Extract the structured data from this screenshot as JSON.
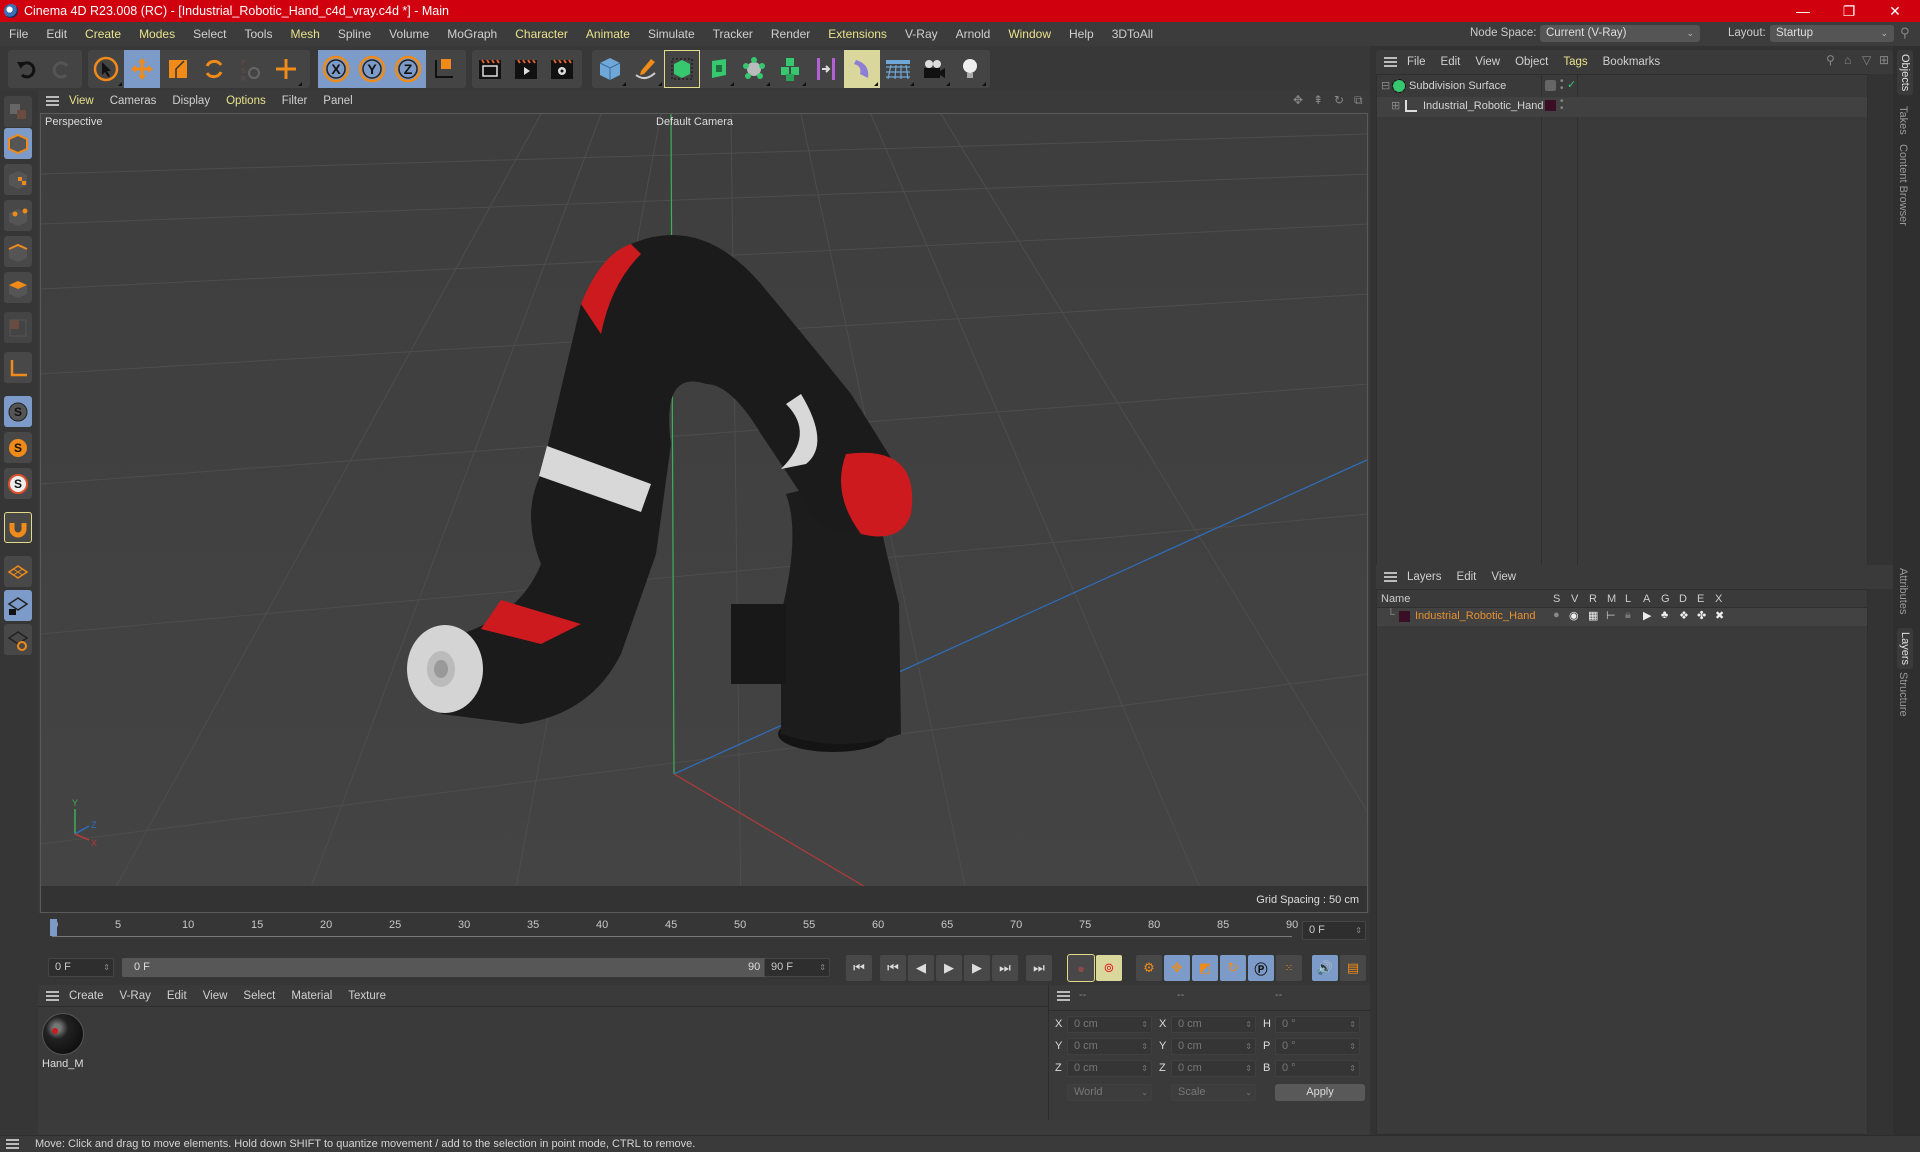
{
  "window": {
    "title": "Cinema 4D R23.008 (RC) - [Industrial_Robotic_Hand_c4d_vray.c4d *] - Main",
    "controls": {
      "minimize": "—",
      "restore": "❐",
      "close": "✕"
    }
  },
  "menubar": {
    "items": [
      {
        "label": "File",
        "hl": false
      },
      {
        "label": "Edit",
        "hl": false
      },
      {
        "label": "Create",
        "hl": true
      },
      {
        "label": "Modes",
        "hl": true
      },
      {
        "label": "Select",
        "hl": false
      },
      {
        "label": "Tools",
        "hl": false
      },
      {
        "label": "Mesh",
        "hl": true
      },
      {
        "label": "Spline",
        "hl": false
      },
      {
        "label": "Volume",
        "hl": false
      },
      {
        "label": "MoGraph",
        "hl": false
      },
      {
        "label": "Character",
        "hl": true
      },
      {
        "label": "Animate",
        "hl": true
      },
      {
        "label": "Simulate",
        "hl": false
      },
      {
        "label": "Tracker",
        "hl": false
      },
      {
        "label": "Render",
        "hl": false
      },
      {
        "label": "Extensions",
        "hl": true
      },
      {
        "label": "V-Ray",
        "hl": false
      },
      {
        "label": "Arnold",
        "hl": false
      },
      {
        "label": "Window",
        "hl": true
      },
      {
        "label": "Help",
        "hl": false
      },
      {
        "label": "3DToAll",
        "hl": false
      }
    ],
    "node_space_label": "Node Space:",
    "node_space_value": "Current (V-Ray)",
    "layout_label": "Layout:",
    "layout_value": "Startup"
  },
  "toolbar": {
    "undo": "undo-icon",
    "redo": "redo-icon",
    "modes": [
      "select-arrow",
      "move",
      "scale",
      "rotate",
      "psr-recent",
      "add-new"
    ],
    "axis": [
      "X",
      "Y",
      "Z"
    ],
    "render": [
      "render-view",
      "render-picture-viewer",
      "render-settings"
    ],
    "create": [
      "cube",
      "pen",
      "subdivision-surface",
      "extrude",
      "cloner",
      "multi-cubes",
      "symmetry",
      "deformer",
      "floor",
      "camera",
      "light"
    ]
  },
  "viewport": {
    "menu": [
      {
        "label": "View",
        "hl": true
      },
      {
        "label": "Cameras",
        "hl": false
      },
      {
        "label": "Display",
        "hl": false
      },
      {
        "label": "Options",
        "hl": true
      },
      {
        "label": "Filter",
        "hl": false
      },
      {
        "label": "Panel",
        "hl": false
      }
    ],
    "label": "Perspective",
    "camera": "Default Camera",
    "grid_spacing": "Grid Spacing : 50 cm",
    "axis_labels": {
      "y": "Y",
      "z": "Z",
      "x": "X"
    },
    "colors": {
      "red_accent": "#cc1a1f",
      "black_body": "#1b1b1b",
      "white_band": "#d8d8d8",
      "y_axis": "#3fae5a",
      "x_axis": "#b33a3a",
      "z_axis": "#2f6fc0"
    }
  },
  "timeline": {
    "ticks": [
      "0",
      "5",
      "10",
      "15",
      "20",
      "25",
      "30",
      "35",
      "40",
      "45",
      "50",
      "55",
      "60",
      "65",
      "70",
      "75",
      "80",
      "85",
      "90"
    ],
    "current_frame_right": "0 F",
    "start_field": "0 F",
    "range_start": "0 F",
    "range_end": "90 F",
    "end_field": "90 F"
  },
  "material_panel": {
    "menu": [
      "Create",
      "V-Ray",
      "Edit",
      "View",
      "Select",
      "Material",
      "Texture"
    ],
    "materials": [
      {
        "name": "Hand_M"
      }
    ]
  },
  "coordinates": {
    "headers": [
      "--",
      "--",
      "--"
    ],
    "rows": [
      {
        "l1": "X",
        "v1": "0 cm",
        "l2": "X",
        "v2": "0 cm",
        "l3": "H",
        "v3": "0 °"
      },
      {
        "l1": "Y",
        "v1": "0 cm",
        "l2": "Y",
        "v2": "0 cm",
        "l3": "P",
        "v3": "0 °"
      },
      {
        "l1": "Z",
        "v1": "0 cm",
        "l2": "Z",
        "v2": "0 cm",
        "l3": "B",
        "v3": "0 °"
      }
    ],
    "space": "World",
    "mode": "Scale",
    "apply": "Apply"
  },
  "objects_panel": {
    "menu": [
      {
        "label": "File",
        "hl": false
      },
      {
        "label": "Edit",
        "hl": false
      },
      {
        "label": "View",
        "hl": false
      },
      {
        "label": "Object",
        "hl": false
      },
      {
        "label": "Tags",
        "hl": true
      },
      {
        "label": "Bookmarks",
        "hl": false
      }
    ],
    "objects": [
      {
        "name": "Subdivision Surface",
        "icon": "subdivision-surface-icon"
      },
      {
        "name": "Industrial_Robotic_Hand",
        "icon": "null-object-icon",
        "layer_color": "#3a0f26"
      }
    ]
  },
  "layers_panel": {
    "menu": [
      "Layers",
      "Edit",
      "View"
    ],
    "columns": [
      "Name",
      "S",
      "V",
      "R",
      "M",
      "L",
      "A",
      "G",
      "D",
      "E",
      "X"
    ],
    "layers": [
      {
        "name": "Industrial_Robotic_Hand",
        "color": "#3a0f26",
        "name_color": "#e89030"
      }
    ]
  },
  "side_tabs": {
    "top": [
      {
        "label": "Objects",
        "active": true
      },
      {
        "label": "Takes",
        "active": false
      },
      {
        "label": "Content Browser",
        "active": false
      }
    ],
    "bottom": [
      {
        "label": "Attributes",
        "active": false
      },
      {
        "label": "Layers",
        "active": true
      },
      {
        "label": "Structure",
        "active": false
      }
    ]
  },
  "status": {
    "text": "Move: Click and drag to move elements. Hold down SHIFT to quantize movement / add to the selection in point mode, CTRL to remove."
  }
}
